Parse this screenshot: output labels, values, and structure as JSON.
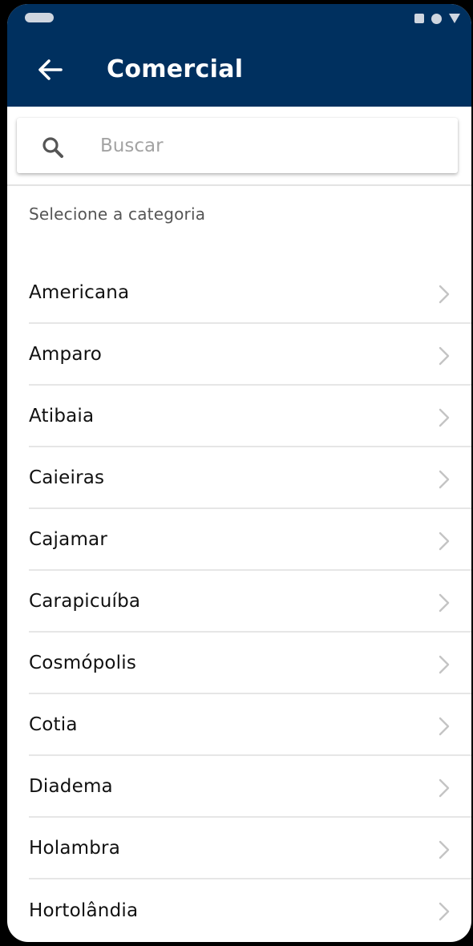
{
  "appbar": {
    "title": "Comercial",
    "back_icon": "arrow-left-icon"
  },
  "search": {
    "placeholder": "Buscar",
    "value": "",
    "icon": "search-icon"
  },
  "section": {
    "label": "Selecione a categoria"
  },
  "items": [
    {
      "label": "Americana"
    },
    {
      "label": "Amparo"
    },
    {
      "label": "Atibaia"
    },
    {
      "label": "Caieiras"
    },
    {
      "label": "Cajamar"
    },
    {
      "label": "Carapicuíba"
    },
    {
      "label": "Cosmópolis"
    },
    {
      "label": "Cotia"
    },
    {
      "label": "Diadema"
    },
    {
      "label": "Holambra"
    },
    {
      "label": "Hortolândia"
    }
  ],
  "colors": {
    "primary": "#00305f",
    "on_primary": "#ffffff",
    "divider": "#e6e6e6",
    "chevron": "#c4c4c4"
  }
}
